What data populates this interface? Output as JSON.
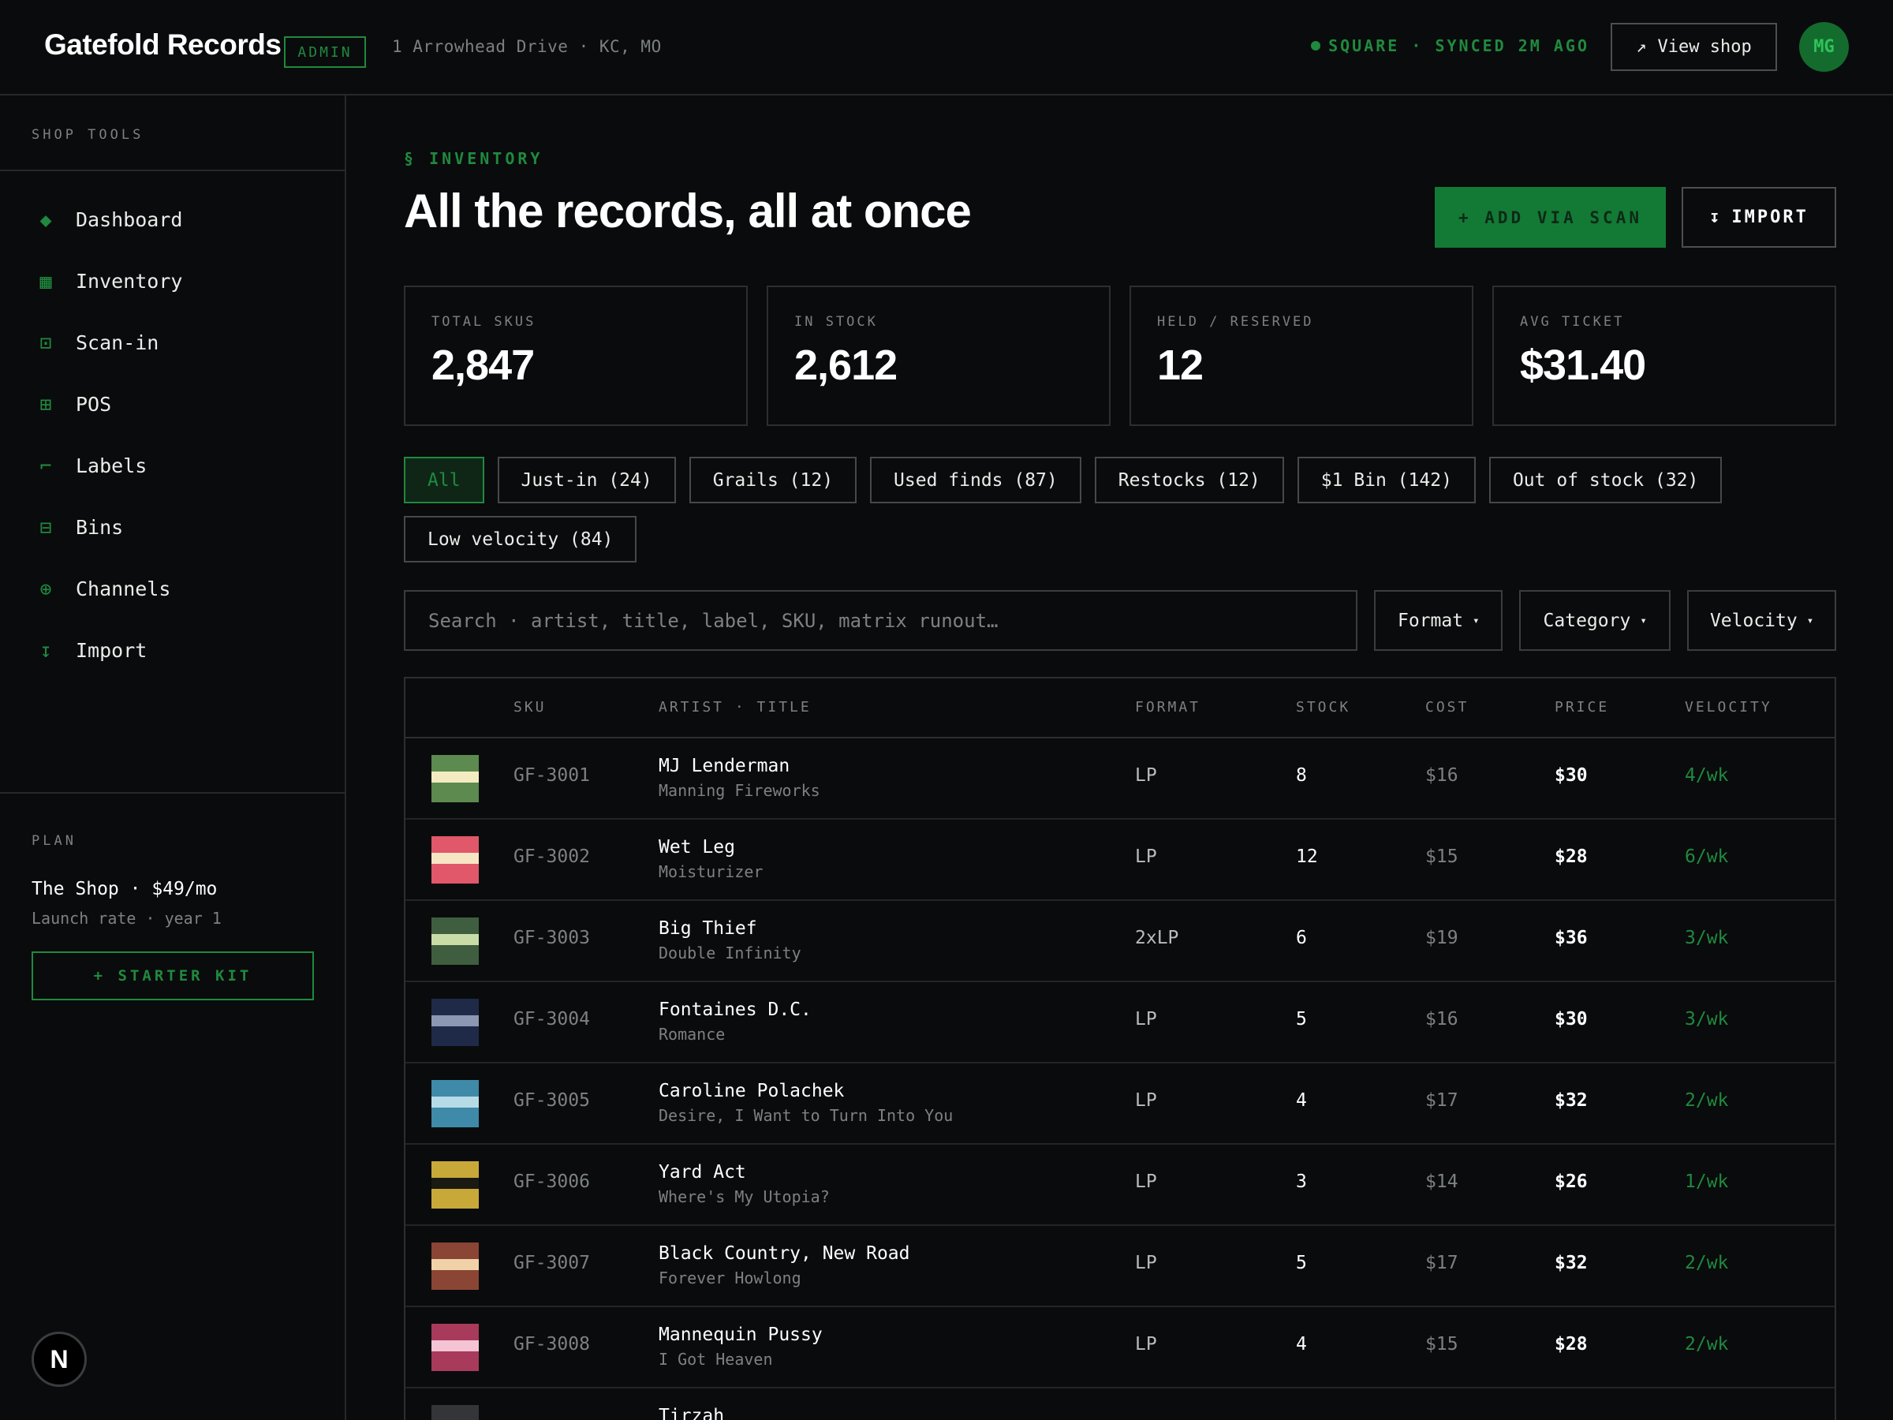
{
  "header": {
    "brand": "Gatefold Records",
    "badge": "ADMIN",
    "address": "1 Arrowhead Drive · KC, MO",
    "sync_status": "SQUARE · SYNCED 2M AGO",
    "view_shop_icon": "↗",
    "view_shop_label": "View shop",
    "avatar_initials": "MG"
  },
  "sidebar": {
    "heading": "SHOP TOOLS",
    "items": [
      {
        "label": "Dashboard",
        "icon": "◆"
      },
      {
        "label": "Inventory",
        "icon": "▦"
      },
      {
        "label": "Scan-in",
        "icon": "⊡"
      },
      {
        "label": "POS",
        "icon": "⊞"
      },
      {
        "label": "Labels",
        "icon": "⌐"
      },
      {
        "label": "Bins",
        "icon": "⊟"
      },
      {
        "label": "Channels",
        "icon": "⊕"
      },
      {
        "label": "Import",
        "icon": "↧"
      }
    ],
    "plan": {
      "label": "PLAN",
      "name": "The Shop · $49/mo",
      "sub": "Launch rate · year 1",
      "cta": "+ STARTER KIT"
    },
    "n_badge": "N"
  },
  "main": {
    "eyebrow": "§ INVENTORY",
    "title": "All the records, all at once",
    "scan_button": "+ ADD VIA SCAN",
    "import_icon": "↧",
    "import_button": "IMPORT",
    "stats": [
      {
        "label": "TOTAL SKUS",
        "value": "2,847"
      },
      {
        "label": "IN STOCK",
        "value": "2,612"
      },
      {
        "label": "HELD / RESERVED",
        "value": "12"
      },
      {
        "label": "AVG TICKET",
        "value": "$31.40"
      }
    ],
    "chips": [
      "All",
      "Just-in (24)",
      "Grails (12)",
      "Used finds (87)",
      "Restocks (12)",
      "$1 Bin (142)",
      "Out of stock (32)",
      "Low velocity (84)"
    ],
    "active_chip": "All",
    "search_placeholder": "Search · artist, title, label, SKU, matrix runout…",
    "dropdowns": [
      "Format",
      "Category",
      "Velocity"
    ],
    "dropdown_caret": "▾",
    "table": {
      "columns": [
        "SKU",
        "ARTIST · TITLE",
        "FORMAT",
        "STOCK",
        "COST",
        "PRICE",
        "VELOCITY"
      ],
      "rows": [
        {
          "sku": "GF-3001",
          "artist": "MJ Lenderman",
          "album": "Manning Fireworks",
          "format": "LP",
          "stock": "8",
          "cost": "$16",
          "price": "$30",
          "velocity": "4/wk",
          "color": "#5c8a4f",
          "band": "#f3ecc0"
        },
        {
          "sku": "GF-3002",
          "artist": "Wet Leg",
          "album": "Moisturizer",
          "format": "LP",
          "stock": "12",
          "cost": "$15",
          "price": "$28",
          "velocity": "6/wk",
          "color": "#e0586a",
          "band": "#f7e6c4"
        },
        {
          "sku": "GF-3003",
          "artist": "Big Thief",
          "album": "Double Infinity",
          "format": "2xLP",
          "stock": "6",
          "cost": "$19",
          "price": "$36",
          "velocity": "3/wk",
          "color": "#3f5e3f",
          "band": "#c9dca7"
        },
        {
          "sku": "GF-3004",
          "artist": "Fontaines D.C.",
          "album": "Romance",
          "format": "LP",
          "stock": "5",
          "cost": "$16",
          "price": "$30",
          "velocity": "3/wk",
          "color": "#1e2a48",
          "band": "#8c97b3"
        },
        {
          "sku": "GF-3005",
          "artist": "Caroline Polachek",
          "album": "Desire, I Want to Turn Into You",
          "format": "LP",
          "stock": "4",
          "cost": "$17",
          "price": "$32",
          "velocity": "2/wk",
          "color": "#3e8aa8",
          "band": "#b7dbe6"
        },
        {
          "sku": "GF-3006",
          "artist": "Yard Act",
          "album": "Where's My Utopia?",
          "format": "LP",
          "stock": "3",
          "cost": "$14",
          "price": "$26",
          "velocity": "1/wk",
          "color": "#c9a83a",
          "band": "#1a1a12"
        },
        {
          "sku": "GF-3007",
          "artist": "Black Country, New Road",
          "album": "Forever Howlong",
          "format": "LP",
          "stock": "5",
          "cost": "$17",
          "price": "$32",
          "velocity": "2/wk",
          "color": "#8a4534",
          "band": "#f1d2a8"
        },
        {
          "sku": "GF-3008",
          "artist": "Mannequin Pussy",
          "album": "I Got Heaven",
          "format": "LP",
          "stock": "4",
          "cost": "$15",
          "price": "$28",
          "velocity": "2/wk",
          "color": "#a83a5c",
          "band": "#f4c4d4"
        },
        {
          "sku": "",
          "artist": "Tirzah",
          "album": "",
          "format": "",
          "stock": "",
          "cost": "",
          "price": "",
          "velocity": "",
          "color": "#333538",
          "band": "#333538"
        }
      ]
    }
  }
}
